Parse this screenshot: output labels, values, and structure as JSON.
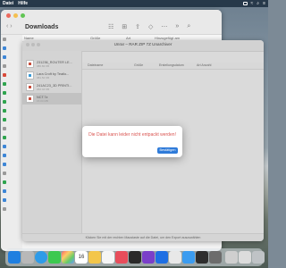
{
  "menubar": {
    "items": [
      "Datei",
      "Hilfe"
    ]
  },
  "finder": {
    "title": "Downloads",
    "nav_arrows": "‹ ›",
    "columns": {
      "name": "Name",
      "size": "Größe",
      "kind": "Art",
      "date_added": "Hinzugefügt am"
    },
    "sidebar_items": [
      "",
      "",
      "",
      "",
      "",
      "",
      "",
      "",
      "",
      "",
      "",
      "",
      "",
      "",
      "",
      "",
      "",
      "",
      "",
      "",
      ""
    ]
  },
  "archive": {
    "title": "Unrar – RAR ZIP 7Z Unarchiver",
    "subtitle": "",
    "items": [
      {
        "name": "231236_ROUTER LE...",
        "meta": "386.84 KB"
      },
      {
        "name": "Lara Croft by Teatlo...",
        "meta": "381.52 KB"
      },
      {
        "name": "241AC23_3D PRINTI...",
        "meta": "262.44 KB"
      },
      {
        "name": "NCT.7z",
        "meta": "15.04 MB"
      }
    ],
    "columns": {
      "name": "Dateiname",
      "size": "Größe",
      "changed": "Erstellungsdatum",
      "type": "Art Anzahl"
    },
    "footer": "Klicken Sie mit der rechten Maustaste auf die Datei, um den Export auszuwählen"
  },
  "dialog": {
    "message": "Die Datei kann leider nicht entpackt werden!",
    "button": "Bestätigen"
  },
  "dock": {
    "calendar_day": "16"
  }
}
